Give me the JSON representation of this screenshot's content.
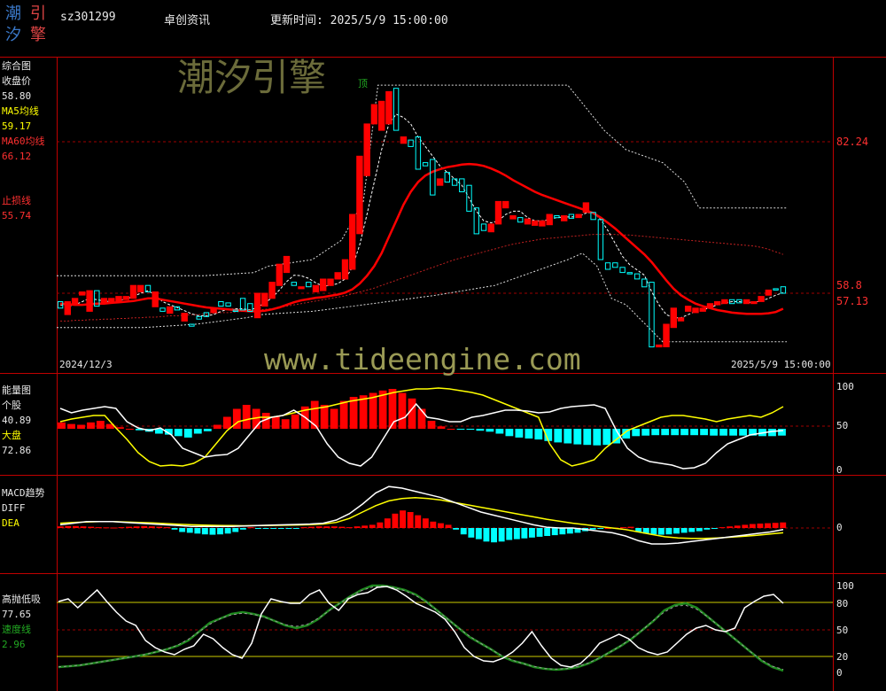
{
  "header": {
    "logo_chars": [
      "潮",
      "引",
      "汐",
      "擎"
    ],
    "stock_code": "sz301299",
    "stock_name": "卓创资讯",
    "update_time": "更新时间: 2025/5/9 15:00:00"
  },
  "watermarks": {
    "brand": "潮汐引擎",
    "url": "www.tideengine.com"
  },
  "colors": {
    "bg": "#000000",
    "up": "#ff0000",
    "down": "#00ffff",
    "ma5": "#ffff00",
    "ma60": "#ff3030",
    "grid": "#8b0000",
    "white_line": "#ffffff",
    "speed": "#228b22"
  },
  "panels": {
    "main": {
      "title": "综合图",
      "close_label": "收盘价",
      "close_value": "58.80",
      "ma5_label": "MA5均线",
      "ma5_value": "59.17",
      "ma60_label": "MA60均线",
      "ma60_value": "66.12",
      "stop_label": "止损线",
      "stop_value": "55.74",
      "top_marker": "顶",
      "date_start": "2024/12/3",
      "date_end": "2025/5/9 15:00:00",
      "price_ticks": [
        "82.24",
        "58.8",
        "57.13"
      ]
    },
    "energy": {
      "title": "能量图",
      "stock_label": "个股",
      "stock_value": "40.89",
      "market_label": "大盘",
      "market_value": "72.86",
      "ticks": [
        "100",
        "50",
        "0"
      ]
    },
    "macd": {
      "title": "MACD趋势",
      "diff_label": "DIFF",
      "dea_label": "DEA",
      "ticks": [
        "0"
      ]
    },
    "highlow": {
      "title": "高抛低吸",
      "value": "77.65",
      "speed_label": "速度线",
      "speed_value": "2.96",
      "ticks": [
        "100",
        "80",
        "50",
        "20",
        "0"
      ]
    }
  },
  "chart_data": {
    "type": "candlestick",
    "categories_range": [
      "2024/12/3",
      "2025/5/9"
    ],
    "y_ticks_main": [
      82.24,
      58.8,
      57.13
    ],
    "candles": [
      {
        "o": 57.5,
        "c": 56.5
      },
      {
        "o": 55.5,
        "c": 57.5
      },
      {
        "o": 57.0,
        "c": 58.0
      },
      {
        "o": 58.5,
        "c": 59.0
      },
      {
        "o": 56.0,
        "c": 59.2
      },
      {
        "o": 59.2,
        "c": 56.8
      },
      {
        "o": 57.3,
        "c": 58.0
      },
      {
        "o": 57.5,
        "c": 58.0
      },
      {
        "o": 57.5,
        "c": 58.3
      },
      {
        "o": 57.8,
        "c": 58.3
      },
      {
        "o": 58.0,
        "c": 60.0
      },
      {
        "o": 59.0,
        "c": 60.0
      },
      {
        "o": 60.0,
        "c": 59.0
      },
      {
        "o": 56.7,
        "c": 59.0
      },
      {
        "o": 56.5,
        "c": 56.0
      },
      {
        "o": 55.7,
        "c": 56.7
      },
      {
        "o": 56.7,
        "c": 56.2
      },
      {
        "o": 54.5,
        "c": 55.7
      },
      {
        "o": 54.0,
        "c": 53.7
      },
      {
        "o": 55.2,
        "c": 54.8
      },
      {
        "o": 55.8,
        "c": 55.2
      },
      {
        "o": 55.8,
        "c": 56.5
      },
      {
        "o": 57.5,
        "c": 56.8
      },
      {
        "o": 57.3,
        "c": 56.8
      },
      {
        "o": 56.2,
        "c": 56.0
      },
      {
        "o": 58.0,
        "c": 56.2
      },
      {
        "o": 57.2,
        "c": 56.0
      },
      {
        "o": 55.0,
        "c": 58.8
      },
      {
        "o": 56.8,
        "c": 58.8
      },
      {
        "o": 58.0,
        "c": 60.5
      },
      {
        "o": 60.0,
        "c": 63.3
      },
      {
        "o": 62.0,
        "c": 64.5
      },
      {
        "o": 60.5,
        "c": 60.0
      },
      {
        "o": 59.5,
        "c": 59.8
      },
      {
        "o": 60.5,
        "c": 59.8
      },
      {
        "o": 59.0,
        "c": 60.0
      },
      {
        "o": 59.2,
        "c": 61.0
      },
      {
        "o": 60.0,
        "c": 61.0
      },
      {
        "o": 61.0,
        "c": 62.0
      },
      {
        "o": 61.0,
        "c": 64.0
      },
      {
        "o": 62.5,
        "c": 71.0
      },
      {
        "o": 68.0,
        "c": 80.0
      },
      {
        "o": 77.0,
        "c": 85.0
      },
      {
        "o": 85.0,
        "c": 88.0
      },
      {
        "o": 84.0,
        "c": 88.5
      },
      {
        "o": 85.0,
        "c": 90.0
      },
      {
        "o": 90.5,
        "c": 84.0
      },
      {
        "o": 82.0,
        "c": 83.0
      },
      {
        "o": 82.5,
        "c": 81.5
      },
      {
        "o": 83.0,
        "c": 78.0
      },
      {
        "o": 79.0,
        "c": 78.5
      },
      {
        "o": 79.5,
        "c": 74.0
      },
      {
        "o": 75.5,
        "c": 76.5
      },
      {
        "o": 77.5,
        "c": 76.0
      },
      {
        "o": 76.5,
        "c": 75.5
      },
      {
        "o": 76.5,
        "c": 74.5
      },
      {
        "o": 75.5,
        "c": 71.5
      },
      {
        "o": 72.0,
        "c": 68.0
      },
      {
        "o": 69.5,
        "c": 68.5
      },
      {
        "o": 68.3,
        "c": 69.5
      },
      {
        "o": 69.5,
        "c": 73.0
      },
      {
        "o": 72.0,
        "c": 73.0
      },
      {
        "o": 70.3,
        "c": 70.8
      },
      {
        "o": 70.5,
        "c": 69.8
      },
      {
        "o": 69.5,
        "c": 70.3
      },
      {
        "o": 69.3,
        "c": 70.0
      },
      {
        "o": 69.2,
        "c": 70.0
      },
      {
        "o": 69.4,
        "c": 71.0
      },
      {
        "o": 70.8,
        "c": 70.5
      },
      {
        "o": 70.0,
        "c": 70.8
      },
      {
        "o": 71.0,
        "c": 70.4
      },
      {
        "o": 70.5,
        "c": 71.0
      },
      {
        "o": 71.3,
        "c": 72.8
      },
      {
        "o": 71.3,
        "c": 70.2
      },
      {
        "o": 70.2,
        "c": 64.0
      },
      {
        "o": 63.5,
        "c": 62.5
      },
      {
        "o": 63.5,
        "c": 62.8
      },
      {
        "o": 62.8,
        "c": 62.0
      },
      {
        "o": 62.0,
        "c": 61.8
      },
      {
        "o": 61.8,
        "c": 61.0
      },
      {
        "o": 61.0,
        "c": 59.8
      },
      {
        "o": 60.5,
        "c": 50.5
      },
      {
        "o": 50.5,
        "c": 50.8
      },
      {
        "o": 50.5,
        "c": 54.0
      },
      {
        "o": 53.5,
        "c": 56.5
      },
      {
        "o": 54.5,
        "c": 55.0
      },
      {
        "o": 56.0,
        "c": 56.8
      },
      {
        "o": 55.8,
        "c": 56.5
      },
      {
        "o": 56.0,
        "c": 56.5
      },
      {
        "o": 56.5,
        "c": 57.2
      },
      {
        "o": 57.0,
        "c": 57.5
      },
      {
        "o": 57.2,
        "c": 57.8
      },
      {
        "o": 57.8,
        "c": 57.2
      },
      {
        "o": 57.8,
        "c": 57.3
      },
      {
        "o": 57.2,
        "c": 57.8
      },
      {
        "o": 57.2,
        "c": 57.5
      },
      {
        "o": 57.5,
        "c": 58.3
      },
      {
        "o": 58.5,
        "c": 59.3
      },
      {
        "o": 59.5,
        "c": 59.3
      },
      {
        "o": 59.8,
        "c": 58.8
      }
    ],
    "ma5": [
      57,
      56.8,
      57,
      57.5,
      58,
      57.8,
      57.6,
      57.5,
      57.7,
      57.9,
      58.3,
      58.8,
      59.2,
      58.5,
      57.5,
      57,
      56.6,
      56.1,
      55.6,
      55.3,
      55.3,
      55.5,
      56,
      56.3,
      56.4,
      56.4,
      56.2,
      56.6,
      57.3,
      58.1,
      59.3,
      60.6,
      61.6,
      61.5,
      61.1,
      60.4,
      59.9,
      60,
      60.3,
      61,
      62.8,
      66.3,
      71,
      76,
      81,
      85,
      86.5,
      86,
      85,
      83,
      81.5,
      80,
      78.5,
      77.5,
      76.5,
      75.5,
      73.5,
      71.5,
      70,
      69.7,
      70,
      71,
      71.5,
      71.5,
      70.5,
      70,
      70,
      70.2,
      70.5,
      70.6,
      70.6,
      70.7,
      71.2,
      71.3,
      70.2,
      68.5,
      66.5,
      64.5,
      63.2,
      62.4,
      61.6,
      59,
      57,
      55.5,
      55,
      55,
      55.5,
      56,
      56.2,
      56.6,
      57,
      57.3,
      57.5,
      57.5,
      57.4,
      57.4,
      57.6,
      58,
      58.5,
      58.9
    ],
    "ma60": [
      54.5,
      54.5,
      54.6,
      54.6,
      54.7,
      54.7,
      54.8,
      54.8,
      54.9,
      54.9,
      55,
      55,
      55.1,
      55.1,
      55.2,
      55.3,
      55.3,
      55.4,
      55.5,
      55.5,
      55.6,
      55.7,
      55.8,
      55.8,
      55.9,
      56,
      56.1,
      56.2,
      56.3,
      56.4,
      56.6,
      56.8,
      57,
      57.2,
      57.4,
      57.6,
      57.8,
      58,
      58.2,
      58.4,
      58.7,
      59,
      59.3,
      59.6,
      60,
      60.4,
      60.8,
      61.2,
      61.6,
      62,
      62.4,
      62.8,
      63.2,
      63.6,
      64,
      64.3,
      64.6,
      64.9,
      65.2,
      65.5,
      65.8,
      66.1,
      66.4,
      66.6,
      66.8,
      67,
      67.2,
      67.3,
      67.4,
      67.5,
      67.6,
      67.7,
      67.8,
      67.9,
      67.9,
      67.9,
      67.9,
      67.8,
      67.8,
      67.7,
      67.6,
      67.5,
      67.4,
      67.3,
      67.2,
      67.1,
      67,
      66.9,
      66.8,
      66.7,
      66.6,
      66.5,
      66.4,
      66.3,
      66.2,
      66.1,
      65.9,
      65.6,
      65.2,
      64.8
    ],
    "ma20_red": [
      57.2,
      57.1,
      57,
      57,
      57.1,
      57.2,
      57.2,
      57.3,
      57.4,
      57.5,
      57.6,
      57.8,
      58,
      58,
      57.8,
      57.6,
      57.4,
      57.2,
      57,
      56.8,
      56.6,
      56.5,
      56.4,
      56.3,
      56.2,
      56.1,
      56,
      56,
      56.1,
      56.3,
      56.6,
      57,
      57.4,
      57.7,
      57.9,
      58.1,
      58.2,
      58.4,
      58.6,
      58.9,
      59.4,
      60.3,
      61.5,
      63,
      65,
      67.5,
      70,
      72.5,
      74.5,
      76,
      77,
      77.6,
      78,
      78.3,
      78.5,
      78.7,
      78.8,
      78.7,
      78.5,
      78.1,
      77.6,
      77,
      76.3,
      75.7,
      75.1,
      74.5,
      74,
      73.6,
      73.2,
      72.8,
      72.4,
      72,
      71.6,
      71.2,
      70.5,
      69.7,
      68.8,
      67.8,
      66.8,
      65.8,
      64.8,
      63.6,
      62.2,
      60.8,
      59.5,
      58.5,
      57.8,
      57.2,
      56.8,
      56.5,
      56.2,
      56,
      55.8,
      55.7,
      55.6,
      55.6,
      55.6,
      55.7,
      55.9,
      56.4
    ],
    "upper_band_steps": [
      [
        0,
        61.5
      ],
      [
        20,
        61.5
      ],
      [
        27,
        62
      ],
      [
        29,
        63
      ],
      [
        35,
        64
      ],
      [
        39,
        67
      ],
      [
        42,
        73
      ],
      [
        44,
        91
      ],
      [
        70,
        91
      ],
      [
        75,
        84
      ],
      [
        78,
        81
      ],
      [
        83,
        79
      ],
      [
        86,
        76
      ],
      [
        88,
        72
      ],
      [
        100,
        72
      ]
    ],
    "lower_band_steps": [
      [
        0,
        53.5
      ],
      [
        12,
        53.5
      ],
      [
        19,
        54
      ],
      [
        26,
        55
      ],
      [
        28,
        55.5
      ],
      [
        35,
        56
      ],
      [
        42,
        57
      ],
      [
        52,
        58.5
      ],
      [
        60,
        60
      ],
      [
        65,
        62
      ],
      [
        70,
        64
      ],
      [
        72,
        65
      ],
      [
        74,
        63
      ],
      [
        76,
        58
      ],
      [
        77,
        57.5
      ],
      [
        78,
        57
      ],
      [
        83,
        51.3
      ],
      [
        100,
        51.3
      ]
    ],
    "energy_stock": [
      70,
      65,
      68,
      70,
      72,
      70,
      55,
      48,
      45,
      48,
      40,
      25,
      20,
      15,
      17,
      18,
      25,
      40,
      55,
      60,
      62,
      68,
      60,
      50,
      30,
      15,
      8,
      5,
      15,
      35,
      55,
      60,
      75,
      60,
      58,
      55,
      55,
      60,
      62,
      65,
      68,
      68,
      67,
      65,
      66,
      70,
      72,
      73,
      74,
      70,
      45,
      25,
      15,
      10,
      8,
      6,
      2,
      3,
      8,
      20,
      30,
      35,
      40,
      42,
      44,
      45
    ],
    "energy_market": [
      55,
      58,
      60,
      62,
      62,
      48,
      35,
      20,
      10,
      5,
      6,
      5,
      8,
      15,
      30,
      45,
      55,
      58,
      60,
      60,
      62,
      65,
      68,
      70,
      72,
      75,
      78,
      80,
      82,
      85,
      88,
      90,
      92,
      92,
      93,
      92,
      90,
      88,
      85,
      80,
      75,
      70,
      65,
      60,
      30,
      12,
      5,
      8,
      12,
      25,
      35,
      45,
      50,
      55,
      60,
      62,
      62,
      60,
      58,
      55,
      58,
      60,
      62,
      60,
      65,
      72
    ],
    "energy_bars": [
      8,
      6,
      5,
      8,
      10,
      6,
      2,
      0,
      -3,
      -6,
      -10,
      -12,
      -15,
      -18,
      -10,
      -5,
      5,
      15,
      25,
      30,
      25,
      20,
      15,
      12,
      18,
      28,
      35,
      30,
      25,
      35,
      40,
      42,
      45,
      48,
      50,
      45,
      38,
      25,
      10,
      3,
      0,
      -1,
      -2,
      -4,
      -6,
      -10,
      -15,
      -18,
      -20,
      -22,
      -25,
      -28,
      -30,
      -32,
      -33,
      -34,
      -33,
      -30,
      -20,
      -15,
      -14,
      -13,
      -13,
      -13,
      -13,
      -13,
      -13,
      -14,
      -14,
      -14,
      -14,
      -14,
      -15,
      -15,
      -14
    ],
    "macd_diff": [
      0.2,
      0.3,
      0.4,
      0.4,
      0.4,
      0.35,
      0.3,
      0.25,
      0.2,
      0.15,
      0.1,
      0.1,
      0.1,
      0.1,
      0.12,
      0.15,
      0.18,
      0.2,
      0.22,
      0.25,
      0.3,
      0.5,
      0.9,
      1.5,
      2.2,
      2.6,
      2.5,
      2.3,
      2.1,
      1.9,
      1.6,
      1.3,
      1.0,
      0.8,
      0.6,
      0.4,
      0.2,
      0.05,
      0,
      0,
      -0.1,
      -0.2,
      -0.3,
      -0.5,
      -0.8,
      -1.0,
      -1.0,
      -0.95,
      -0.85,
      -0.75,
      -0.65,
      -0.55,
      -0.45,
      -0.35,
      -0.25,
      -0.1
    ],
    "macd_dea": [
      0.3,
      0.35,
      0.38,
      0.4,
      0.4,
      0.38,
      0.35,
      0.32,
      0.28,
      0.24,
      0.2,
      0.18,
      0.16,
      0.15,
      0.14,
      0.15,
      0.16,
      0.17,
      0.19,
      0.21,
      0.25,
      0.35,
      0.6,
      1.0,
      1.4,
      1.7,
      1.85,
      1.9,
      1.85,
      1.75,
      1.6,
      1.45,
      1.3,
      1.15,
      1.0,
      0.85,
      0.7,
      0.55,
      0.42,
      0.3,
      0.2,
      0.1,
      0,
      -0.1,
      -0.25,
      -0.4,
      -0.55,
      -0.62,
      -0.65,
      -0.65,
      -0.62,
      -0.58,
      -0.52,
      -0.46,
      -0.38,
      -0.3
    ],
    "macd_bars": [
      0.1,
      0.12,
      0.12,
      0.1,
      0.08,
      0.05,
      0.04,
      0.03,
      0.05,
      0.08,
      0.1,
      0.12,
      0.1,
      0.08,
      0.05,
      -0.1,
      -0.25,
      -0.3,
      -0.35,
      -0.4,
      -0.42,
      -0.4,
      -0.35,
      -0.25,
      -0.1,
      0.05,
      -0.05,
      -0.05,
      -0.05,
      -0.05,
      -0.05,
      -0.05,
      0.05,
      0.08,
      0.1,
      0.1,
      0.1,
      0.08,
      0.05,
      0.1,
      0.15,
      0.2,
      0.35,
      0.6,
      0.9,
      1.1,
      1.0,
      0.8,
      0.6,
      0.4,
      0.3,
      0.2,
      -0.1,
      -0.4,
      -0.6,
      -0.7,
      -0.85,
      -0.9,
      -0.85,
      -0.75,
      -0.7,
      -0.65,
      -0.6,
      -0.55,
      -0.5,
      -0.45,
      -0.4,
      -0.35,
      -0.3,
      -0.2,
      -0.1,
      -0.05,
      0,
      0.02,
      0.05,
      0.08,
      -0.25,
      -0.35,
      -0.4,
      -0.42,
      -0.4,
      -0.35,
      -0.3,
      -0.25,
      -0.2,
      -0.1,
      -0.05,
      0.05,
      0.1,
      0.15,
      0.2,
      0.25,
      0.28,
      0.3,
      0.32,
      0.35
    ],
    "highlow_white": [
      82,
      85,
      75,
      85,
      95,
      82,
      70,
      60,
      55,
      38,
      30,
      25,
      22,
      28,
      32,
      45,
      40,
      30,
      22,
      18,
      35,
      68,
      85,
      82,
      80,
      80,
      90,
      95,
      80,
      72,
      85,
      90,
      92,
      98,
      99,
      95,
      88,
      80,
      75,
      70,
      62,
      48,
      30,
      20,
      15,
      14,
      18,
      25,
      35,
      48,
      32,
      18,
      10,
      8,
      12,
      22,
      35,
      40,
      45,
      40,
      30,
      25,
      22,
      25,
      35,
      45,
      52,
      55,
      50,
      48,
      52,
      75,
      82,
      88,
      90,
      80
    ],
    "highlow_green": [
      8,
      9,
      10,
      12,
      14,
      16,
      18,
      20,
      22,
      25,
      28,
      32,
      38,
      48,
      58,
      63,
      68,
      70,
      68,
      65,
      60,
      55,
      52,
      55,
      62,
      72,
      80,
      88,
      95,
      100,
      100,
      98,
      95,
      90,
      82,
      72,
      62,
      52,
      42,
      35,
      28,
      20,
      15,
      12,
      8,
      6,
      5,
      6,
      8,
      12,
      18,
      25,
      32,
      40,
      50,
      60,
      72,
      78,
      80,
      75,
      65,
      55,
      45,
      35,
      25,
      15,
      8,
      4
    ]
  }
}
